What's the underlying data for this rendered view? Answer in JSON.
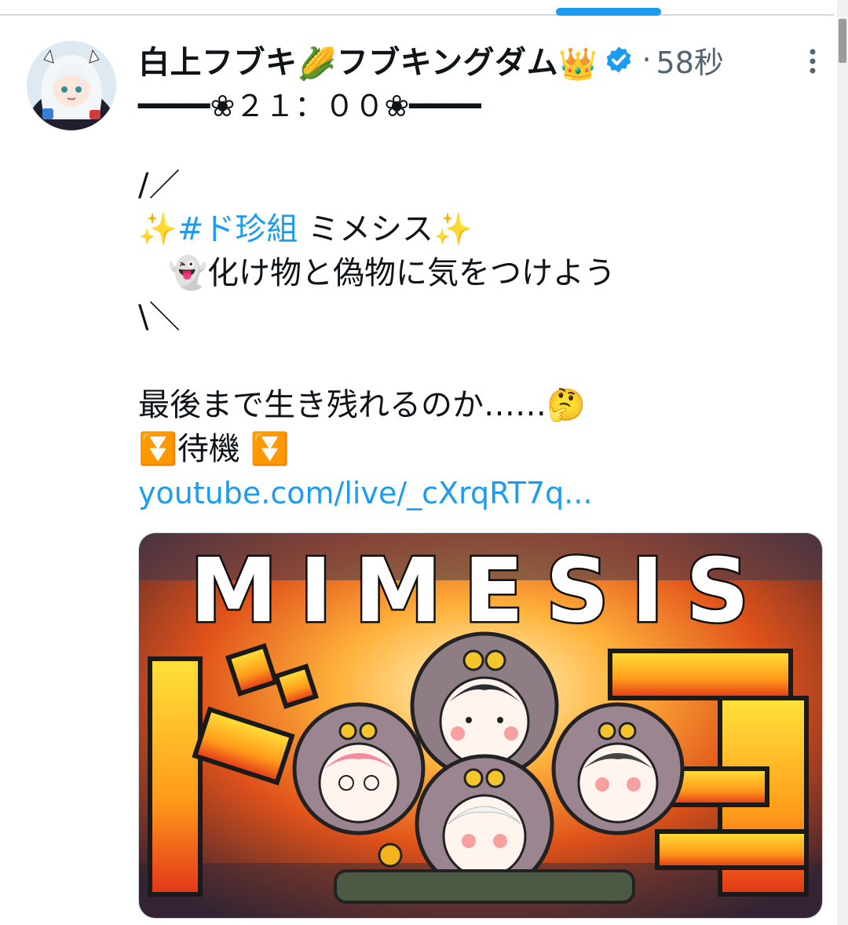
{
  "header": {
    "display_name": "白上フブキ",
    "name_emoji_corn": "🌽",
    "display_name_2": "フブキングダム",
    "name_emoji_crown": "👑",
    "dot": "·",
    "timestamp": "58秒",
    "handle_line": "━━━━❀２１：００❀━━━━"
  },
  "body": {
    "line1": "/／",
    "sparkle_a": "✨",
    "hashtag": "#ド珍組",
    "line2_rest": " ミメシス",
    "sparkle_b": "✨",
    "line3_emoji": "👻",
    "line3_text": "化け物と偽物に気をつけよう",
    "line4": "\\＼",
    "line5_text": "最後まで生き残れるのか……",
    "line5_emoji": "🤔",
    "line6_emoji_a": "⏬",
    "line6_text": "待機",
    "line6_emoji_b": "⏬",
    "link": "youtube.com/live/_cXrqRT7q..."
  },
  "media": {
    "title_text": "MIMESIS",
    "kanji_text": "ド珍"
  },
  "colors": {
    "accent": "#1d9bf0",
    "text": "#0f1419",
    "muted": "#536471"
  },
  "icons": {
    "verified": "verified-badge-icon",
    "more": "more-vertical-icon"
  }
}
